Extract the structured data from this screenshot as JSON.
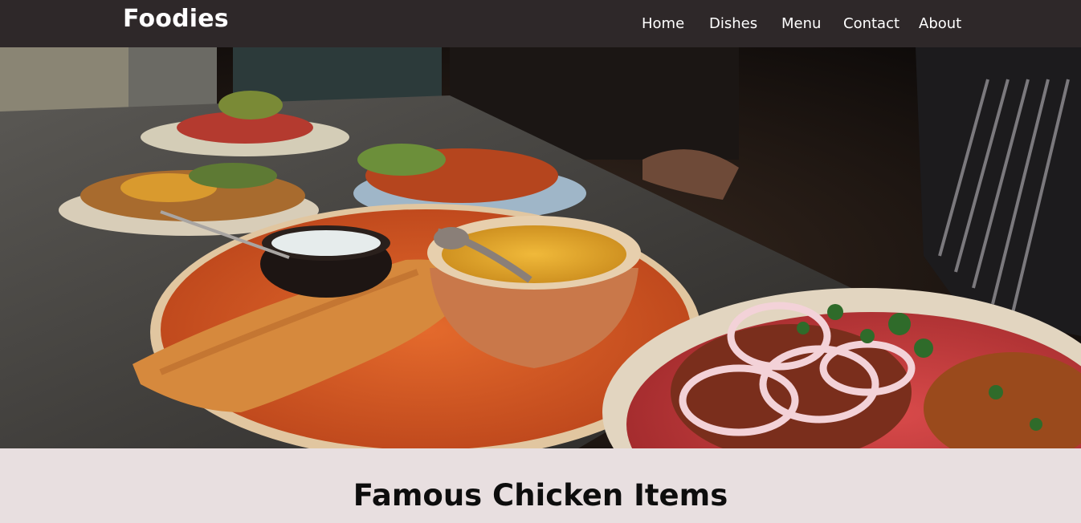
{
  "brand": "Foodies",
  "nav": [
    {
      "label": "Home"
    },
    {
      "label": "Dishes"
    },
    {
      "label": "Menu"
    },
    {
      "label": "Contact"
    },
    {
      "label": "About"
    }
  ],
  "hero": {
    "image_icon": "food-photo"
  },
  "section": {
    "title": "Famous Chicken Items"
  },
  "colors": {
    "navbar": "#2e2829",
    "page_bg": "#e8dfe0",
    "text_light": "#ffffff",
    "title": "#0d0d0d"
  }
}
